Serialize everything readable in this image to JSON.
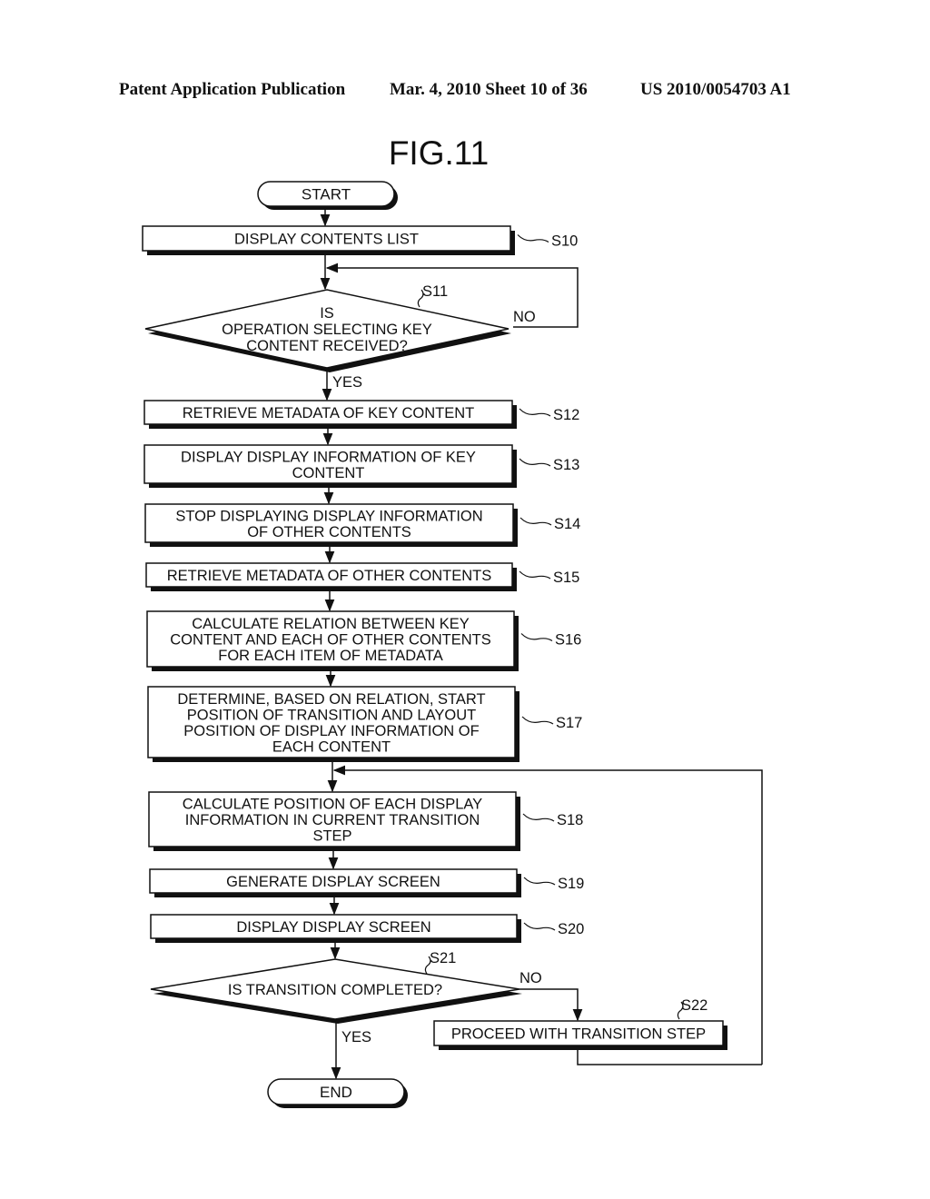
{
  "header": {
    "left": "Patent Application Publication",
    "middle": "Mar. 4, 2010   Sheet 10 of 36",
    "right": "US 2010/0054703 A1"
  },
  "figure": {
    "title": "FIG.11"
  },
  "terminals": {
    "start": "START",
    "end": "END"
  },
  "steps": [
    {
      "id": "S10",
      "lines": [
        "DISPLAY CONTENTS LIST"
      ]
    },
    {
      "id": "S11",
      "lines": [
        "IS",
        "OPERATION SELECTING KEY",
        "CONTENT RECEIVED?"
      ],
      "type": "decision"
    },
    {
      "id": "S12",
      "lines": [
        "RETRIEVE METADATA OF KEY CONTENT"
      ]
    },
    {
      "id": "S13",
      "lines": [
        "DISPLAY DISPLAY INFORMATION OF KEY",
        "CONTENT"
      ]
    },
    {
      "id": "S14",
      "lines": [
        "STOP DISPLAYING DISPLAY INFORMATION",
        "OF OTHER CONTENTS"
      ]
    },
    {
      "id": "S15",
      "lines": [
        "RETRIEVE METADATA OF OTHER CONTENTS"
      ]
    },
    {
      "id": "S16",
      "lines": [
        "CALCULATE RELATION BETWEEN KEY",
        "CONTENT AND EACH OF OTHER CONTENTS",
        "FOR EACH ITEM OF METADATA"
      ]
    },
    {
      "id": "S17",
      "lines": [
        "DETERMINE, BASED ON RELATION, START",
        "POSITION OF TRANSITION AND LAYOUT",
        "POSITION OF DISPLAY INFORMATION OF",
        "EACH CONTENT"
      ]
    },
    {
      "id": "S18",
      "lines": [
        "CALCULATE POSITION OF EACH DISPLAY",
        "INFORMATION IN CURRENT TRANSITION",
        "STEP"
      ]
    },
    {
      "id": "S19",
      "lines": [
        "GENERATE DISPLAY SCREEN"
      ]
    },
    {
      "id": "S20",
      "lines": [
        "DISPLAY DISPLAY SCREEN"
      ]
    },
    {
      "id": "S21",
      "lines": [
        "IS TRANSITION COMPLETED?"
      ],
      "type": "decision"
    },
    {
      "id": "S22",
      "lines": [
        "PROCEED WITH TRANSITION STEP"
      ]
    }
  ],
  "branch_labels": {
    "s11_yes": "YES",
    "s11_no": "NO",
    "s21_yes": "YES",
    "s21_no": "NO"
  }
}
